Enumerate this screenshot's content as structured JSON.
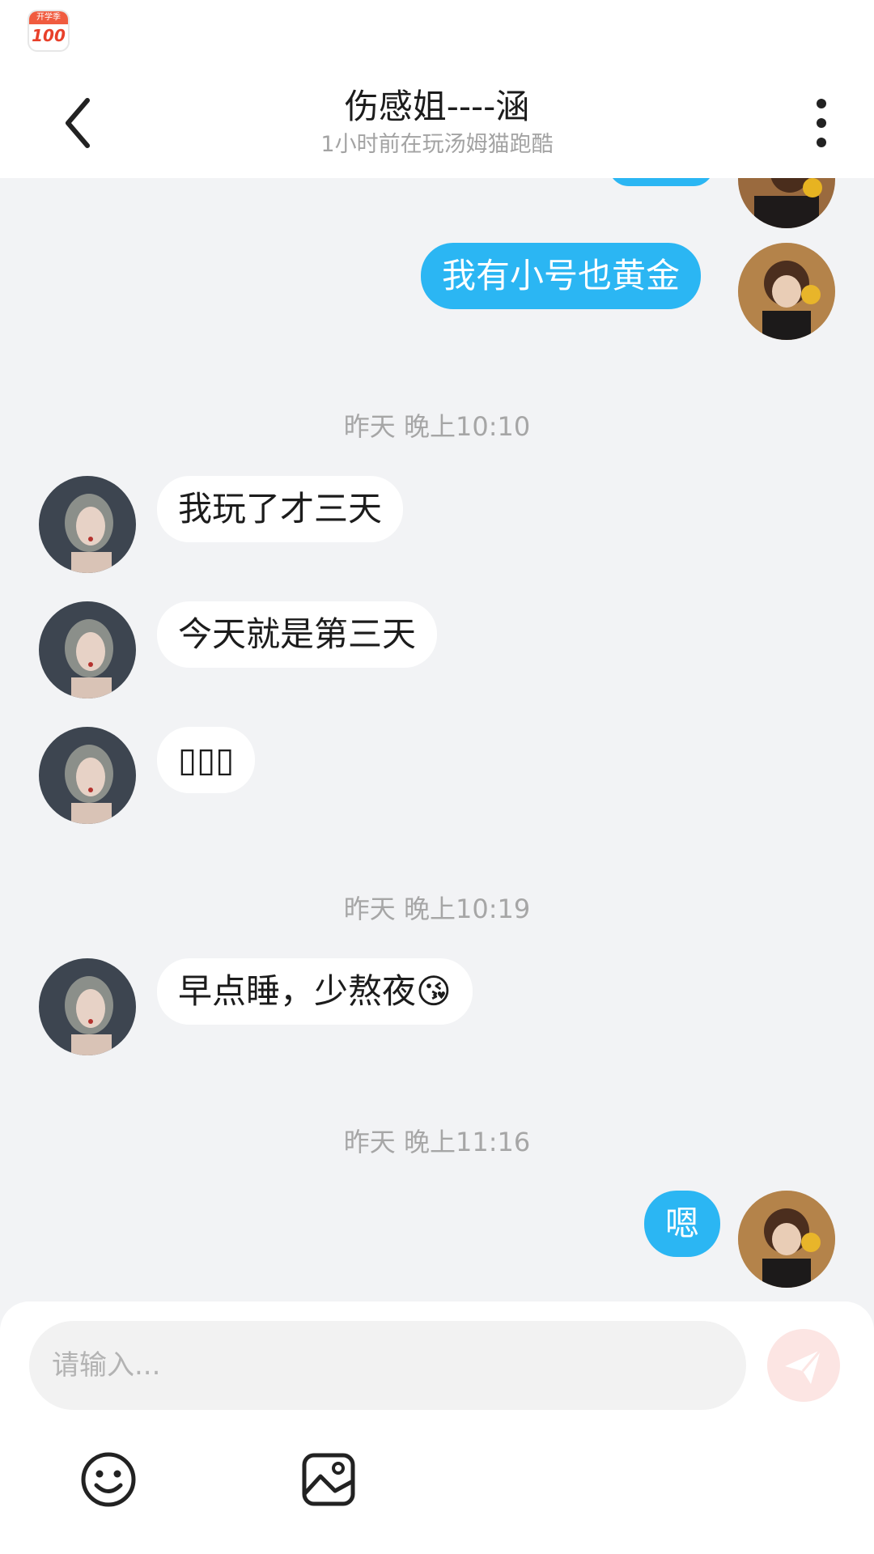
{
  "header": {
    "title": "伤感姐----涵",
    "subtitle": "1小时前在玩汤姆猫跑酷"
  },
  "app_badge": {
    "text": "100",
    "label": "开学季"
  },
  "messages": {
    "m1": "我有小号也黄金",
    "t1": "昨天 晚上10:10",
    "m2": "我玩了才三天",
    "m3": "今天就是第三天",
    "m4": "▯▯▯",
    "t2": "昨天 晚上10:19",
    "m5": "早点睡，少熬夜😘",
    "t3": "昨天 晚上11:16",
    "m6": "嗯"
  },
  "input": {
    "placeholder": "请输入..."
  },
  "icons": {
    "back": "chevron-left-icon",
    "more": "more-vertical-icon",
    "emoji": "smile-icon",
    "image": "image-icon",
    "send": "send-icon"
  },
  "colors": {
    "my_bubble": "#2bb6f3",
    "their_bubble": "#ffffff",
    "send_button": "#fce5e3"
  }
}
